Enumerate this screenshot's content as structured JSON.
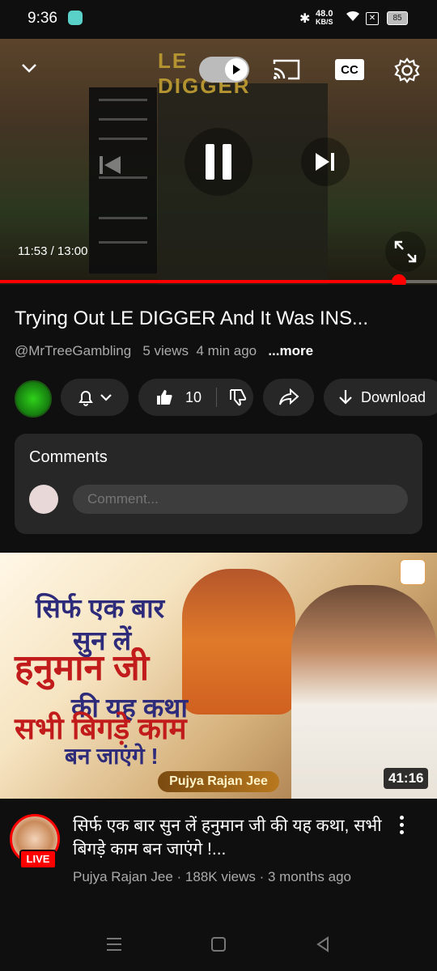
{
  "status_bar": {
    "time": "9:36",
    "net_speed_value": "48.0",
    "net_speed_unit": "KB/S",
    "battery": "85"
  },
  "player": {
    "time_display": "11:53 / 13:00",
    "progress_fraction": 0.913,
    "game_title_art": "LE DIGGER",
    "cc_label": "CC"
  },
  "video": {
    "title": "Trying Out LE DIGGER And It Was INS...",
    "channel": "@MrTreeGambling",
    "views": "5 views",
    "age": "4 min ago",
    "more": "...more"
  },
  "actions": {
    "likes": "10",
    "download_label": "Download"
  },
  "comments": {
    "header": "Comments",
    "placeholder": "Comment..."
  },
  "next_video": {
    "thumb_line1": "सिर्फ एक बार",
    "thumb_line2": "सुन लें",
    "thumb_line3": "हनुमान जी",
    "thumb_line4": "की यह कथा",
    "thumb_line5": "सभी बिगड़े काम",
    "thumb_line6": "बन जाएंगे !",
    "thumb_badge": "Pujya Rajan Jee",
    "duration": "41:16",
    "title": "सिर्फ एक बार सुन लें हनुमान जी की यह कथा, सभी बिगड़े काम बन जाएंगे !...",
    "channel": "Pujya Rajan Jee",
    "views": "188K views",
    "age": "3 months ago",
    "live_label": "LIVE"
  },
  "colors": {
    "accent": "#ff0000",
    "surface": "#272727",
    "background": "#0f0f0f"
  }
}
